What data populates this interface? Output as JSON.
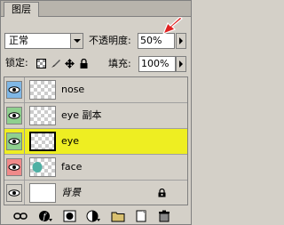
{
  "tab": {
    "label": "图层"
  },
  "blend_mode": {
    "value": "正常"
  },
  "opacity": {
    "label": "不透明度:",
    "value": "50%"
  },
  "lock": {
    "label": "锁定:"
  },
  "fill": {
    "label": "填充:",
    "value": "100%"
  },
  "layers": [
    {
      "name": "nose",
      "eye_color": "#7fb7e6",
      "thumb": "checker"
    },
    {
      "name": "eye 副本",
      "eye_color": "#8fd08f",
      "thumb": "checker"
    },
    {
      "name": "eye",
      "eye_color": "#8fd08f",
      "thumb": "checker",
      "selected": true
    },
    {
      "name": "face",
      "eye_color": "#f08a8a",
      "thumb": "checker"
    },
    {
      "name": "背景",
      "eye_color": "#d4d0c8",
      "thumb": "white",
      "locked": true
    }
  ],
  "colors": {
    "selected_row": "#eeee22",
    "panel_bg": "#d4d0c8",
    "cursor_arrow": "#e02020"
  },
  "toolbar_icons": [
    "link-icon",
    "layer-style-icon",
    "mask-icon",
    "adjustment-icon",
    "group-folder-icon",
    "new-layer-icon",
    "trash-icon"
  ]
}
